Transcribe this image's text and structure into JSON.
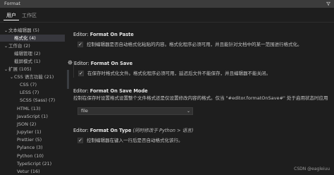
{
  "search": {
    "value": "Format",
    "icon": "filter-icon"
  },
  "tabs": {
    "user": "用户",
    "workspace": "工作区"
  },
  "toc": [
    {
      "label": "文本编辑器 (5)",
      "expanded": true,
      "level": 0
    },
    {
      "label": "格式化 (4)",
      "selected": true,
      "level": 1
    },
    {
      "label": "工作台 (2)",
      "expanded": true,
      "level": 0
    },
    {
      "label": "编辑管理 (2)",
      "level": 1
    },
    {
      "label": "截屏模式 (1)",
      "level": 1
    },
    {
      "label": "扩展 (105)",
      "expanded": true,
      "level": 0
    },
    {
      "label": "CSS 语言功能 (21)",
      "expanded": true,
      "level": 1
    },
    {
      "label": "CSS (7)",
      "level": 2
    },
    {
      "label": "LESS (7)",
      "level": 2
    },
    {
      "label": "SCSS (Sass) (7)",
      "level": 2
    },
    {
      "label": "HTML (13)",
      "level": 1
    },
    {
      "label": "JavaScript (1)",
      "level": 1
    },
    {
      "label": "JSON (2)",
      "level": 1
    },
    {
      "label": "Jupyter (1)",
      "level": 1
    },
    {
      "label": "Prettier (5)",
      "level": 1
    },
    {
      "label": "Pylance (3)",
      "level": 1
    },
    {
      "label": "Python (10)",
      "level": 1
    },
    {
      "label": "TypeScript (21)",
      "level": 1
    },
    {
      "label": "Vetur (16)",
      "level": 1
    }
  ],
  "settings": {
    "format_on_paste": {
      "category": "Editor: ",
      "name": "Format On Paste",
      "checked": true,
      "description": "控制编辑器是否自动格式化粘贴的内容。格式化程序必须可用，并且能针对文档中的某一范围进行格式化。"
    },
    "format_on_save": {
      "category": "Editor: ",
      "name": "Format On Save",
      "checked": true,
      "description": "在保存时格式化文件。格式化程序必须可用，延迟后文件不能保存，并且编辑器不能关闭。"
    },
    "format_on_save_mode": {
      "category": "Editor: ",
      "name": "Format On Save Mode",
      "description": "控制在保存时设置格式设置整个文件格式还是仅设置修改内容的格式。仅当 \"#editor.formatOnSave#\" 处于启用状态时应用",
      "value": "file"
    },
    "format_on_type": {
      "category": "Editor: ",
      "name": "Format On Type",
      "extra": "(同时修改于 Python > 语言)",
      "checked": true,
      "description": "控制编辑器在键入一行后是否自动格式化该行。"
    }
  },
  "watermark": "CSDN @eagleiuu"
}
